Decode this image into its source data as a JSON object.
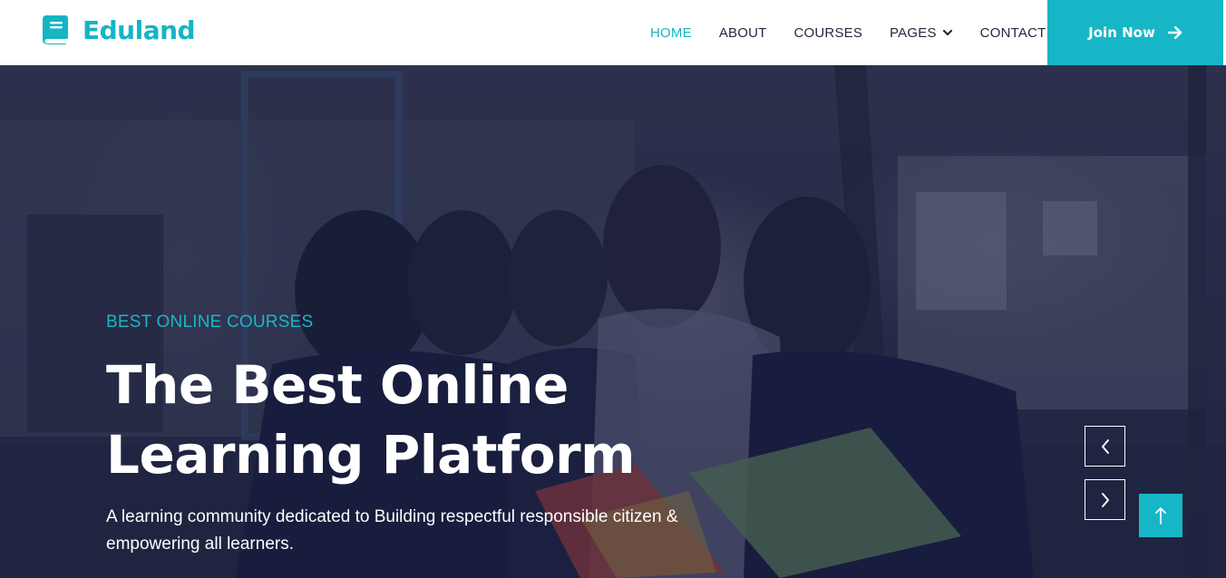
{
  "brand": {
    "name": "Eduland",
    "icon": "book-icon",
    "color": "#15b5c4"
  },
  "nav": {
    "items": [
      {
        "label": "HOME",
        "active": true
      },
      {
        "label": "ABOUT",
        "active": false
      },
      {
        "label": "COURSES",
        "active": false
      },
      {
        "label": "PAGES",
        "active": false,
        "dropdown": true
      },
      {
        "label": "CONTACT",
        "active": false
      }
    ],
    "cta": {
      "label": "Join Now",
      "icon": "arrow-right-icon",
      "color": "#17b6c7"
    }
  },
  "hero": {
    "kicker": "BEST ONLINE COURSES",
    "headline_line1": "The Best Online",
    "headline_line2": "Learning Platform",
    "subtext": "A learning community dedicated to Building respectful responsible citizen & empowering all learners.",
    "controls": {
      "prev_icon": "chevron-left-icon",
      "next_icon": "chevron-right-icon"
    }
  },
  "scroll_top": {
    "icon": "arrow-up-icon"
  }
}
